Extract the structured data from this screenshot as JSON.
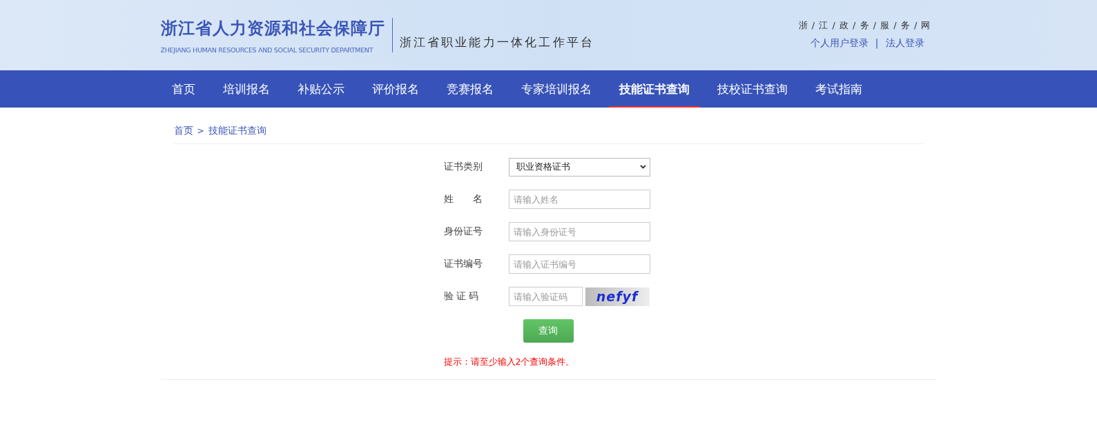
{
  "header": {
    "org_name": "浙江省人力资源和社会保障厅",
    "org_name_en": "ZHEJIANG HUMAN RESOURCES AND SOCIAL SECURITY DEPARTMENT",
    "platform": "浙江省职业能力一体化工作平台",
    "portal_link": "浙 / 江 / 政 / 务 / 服 / 务 / 网",
    "logins": [
      "个人用户登录",
      "法人登录"
    ],
    "login_separator": "|"
  },
  "nav": [
    {
      "label": "首页",
      "selected": false
    },
    {
      "label": "培训报名",
      "selected": false
    },
    {
      "label": "补贴公示",
      "selected": false
    },
    {
      "label": "评价报名",
      "selected": false
    },
    {
      "label": "竞赛报名",
      "selected": false
    },
    {
      "label": "专家培训报名",
      "selected": false
    },
    {
      "label": "技能证书查询",
      "selected": true
    },
    {
      "label": "技校证书查询",
      "selected": false
    },
    {
      "label": "考试指南",
      "selected": false
    }
  ],
  "breadcrumb": {
    "items": [
      "首页",
      "技能证书查询"
    ],
    "separator": ">"
  },
  "form": {
    "fields": [
      {
        "kind": "select",
        "label": "证书类别",
        "value": "职业资格证书"
      },
      {
        "kind": "text",
        "label": "姓　　名",
        "placeholder": "请输入姓名"
      },
      {
        "kind": "text",
        "label": "身份证号",
        "placeholder": "请输入身份证号"
      },
      {
        "kind": "text",
        "label": "证书编号",
        "placeholder": "请输入证书编号"
      },
      {
        "kind": "captcha",
        "label": "验 证 码",
        "placeholder": "请输入验证码",
        "captcha_text": "nefyf"
      }
    ],
    "submit": "查询",
    "hint": "提示：请至少输入2个查询条件。"
  }
}
